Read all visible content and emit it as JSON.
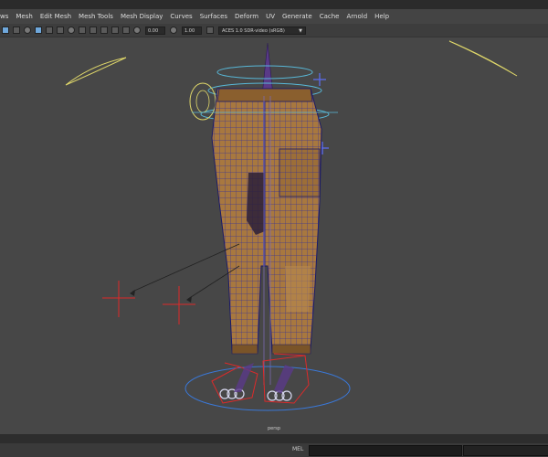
{
  "menu": {
    "items": [
      "ws",
      "Mesh",
      "Edit Mesh",
      "Mesh Tools",
      "Mesh Display",
      "Curves",
      "Surfaces",
      "Deform",
      "UV",
      "Generate",
      "Cache",
      "Arnold",
      "Help"
    ]
  },
  "toolbar": {
    "field_a": "0.00",
    "field_b": "1.00",
    "color_space": "ACES 1.0 SDR-video (sRGB)"
  },
  "viewport": {
    "camera_label": "persp"
  },
  "command_line": {
    "label": "MEL"
  },
  "colors": {
    "viewport_bg": "#474747",
    "menu_bg": "#444444",
    "pants": "#a8783f",
    "wire": "#2222aa",
    "control_yellow": "#e0d86a",
    "control_cyan": "#58b8d8",
    "locator_red": "#dd2a2a"
  }
}
